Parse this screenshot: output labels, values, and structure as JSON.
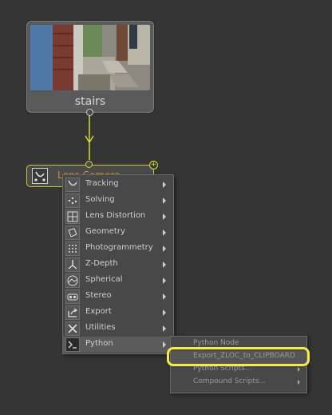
{
  "source_node": {
    "name": "stairs"
  },
  "tracker_node": {
    "label": "Lens Camera"
  },
  "context_menu": {
    "items": [
      {
        "label": "Tracking",
        "icon": "tracking-icon",
        "has_submenu": true
      },
      {
        "label": "Solving",
        "icon": "solving-icon",
        "has_submenu": true
      },
      {
        "label": "Lens Distortion",
        "icon": "lens-distortion-icon",
        "has_submenu": true
      },
      {
        "label": "Geometry",
        "icon": "geometry-icon",
        "has_submenu": true
      },
      {
        "label": "Photogrammetry",
        "icon": "photogrammetry-icon",
        "has_submenu": true
      },
      {
        "label": "Z-Depth",
        "icon": "z-depth-icon",
        "has_submenu": true
      },
      {
        "label": "Spherical",
        "icon": "spherical-icon",
        "has_submenu": true
      },
      {
        "label": "Stereo",
        "icon": "stereo-icon",
        "has_submenu": true
      },
      {
        "label": "Export",
        "icon": "export-icon",
        "has_submenu": true
      },
      {
        "label": "Utilities",
        "icon": "utilities-icon",
        "has_submenu": true
      },
      {
        "label": "Python",
        "icon": "python-icon",
        "has_submenu": true,
        "highlighted": true
      }
    ]
  },
  "python_submenu": {
    "items": [
      {
        "label": "Python Node",
        "has_submenu": false
      },
      {
        "label": "Export_ZLOC_to_CLIPBOARD",
        "has_submenu": false,
        "highlighted": true
      },
      {
        "label": "Python Scripts...",
        "has_submenu": true
      },
      {
        "label": "Compound Scripts...",
        "has_submenu": true
      }
    ]
  },
  "colors": {
    "link": "#d8d73a",
    "tracker_label": "#d99425",
    "highlight_ring": "#f3ec42",
    "background": "#353535"
  }
}
